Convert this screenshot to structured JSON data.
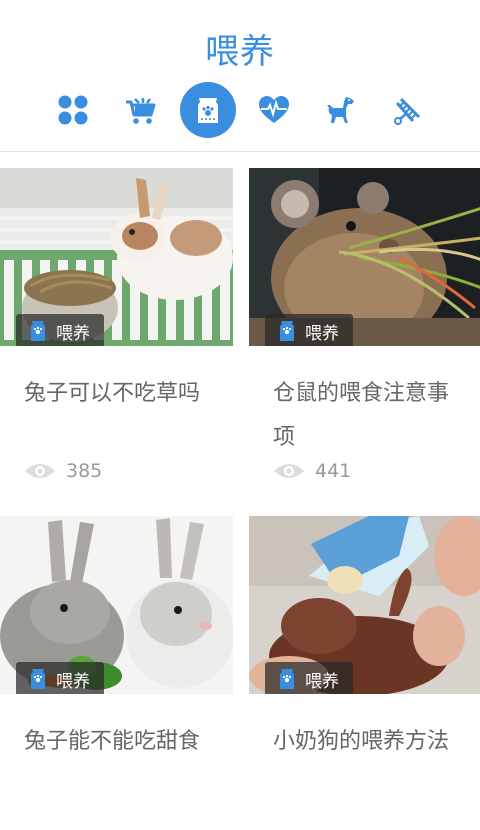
{
  "header": {
    "title": "喂养",
    "categories": [
      {
        "icon": "grid-icon",
        "active": false
      },
      {
        "icon": "cart-icon",
        "active": false
      },
      {
        "icon": "food-bag-icon",
        "active": true
      },
      {
        "icon": "heart-pulse-icon",
        "active": false
      },
      {
        "icon": "dog-icon",
        "active": false
      },
      {
        "icon": "grooming-icon",
        "active": false
      }
    ]
  },
  "colors": {
    "accent": "#3a8ee0",
    "tag_bg": "#2a2a2a",
    "title_text": "#666666",
    "meta_text": "#9a9a9a"
  },
  "cards": [
    {
      "image": "rabbit-eating-hay-photo",
      "tag": "喂养",
      "title": "兔子可以不吃草吗",
      "views": "385"
    },
    {
      "image": "pika-with-grass-photo",
      "tag": "喂养",
      "title": "仓鼠的喂食注意事项",
      "views": "441"
    },
    {
      "image": "two-rabbits-photo",
      "tag": "喂养",
      "title": "兔子能不能吃甜食",
      "views": ""
    },
    {
      "image": "puppy-bottle-feeding-photo",
      "tag": "喂养",
      "title": "小奶狗的喂养方法",
      "views": ""
    }
  ]
}
